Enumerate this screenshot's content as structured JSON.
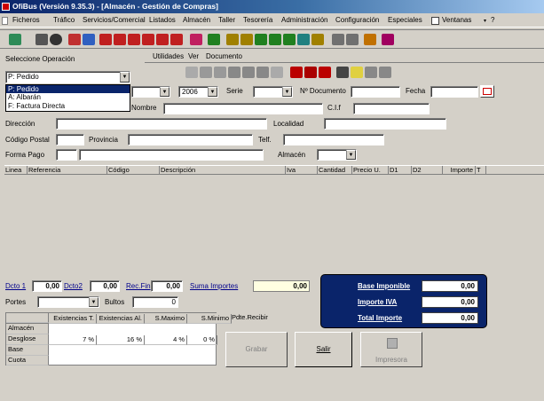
{
  "titlebar": {
    "text": "OfiBus (Versión 9.35.3) - [Almacén - Gestión de Compras]"
  },
  "menu": {
    "items": [
      "Ficheros",
      "Tráfico",
      "Servicios/Comercial",
      "Listados",
      "Almacén",
      "Taller",
      "Tesorería",
      "Administración",
      "Configuración",
      "Especiales",
      "Ventanas",
      "?"
    ]
  },
  "operation": {
    "label": "Seleccione Operación",
    "selected": "P: Pedido",
    "options": [
      "P: Pedido",
      "A: Albarán",
      "F: Factura Directa"
    ]
  },
  "submenu": {
    "items": [
      "Utilidades",
      "Ver",
      "Documento"
    ]
  },
  "form": {
    "year": "2006",
    "serie_label": "Serie",
    "ndoc_label": "Nº Documento",
    "fecha_label": "Fecha",
    "nombre_label": "Nombre",
    "cif_label": "C.I.f",
    "direccion_label": "Dirección",
    "localidad_label": "Localidad",
    "cp_label": "Código Postal",
    "provincia_label": "Provincia",
    "telf_label": "Telf.",
    "formapago_label": "Forma Pago",
    "almacen_label": "Almacén"
  },
  "lines": {
    "columns": [
      "Linea",
      "Referencia",
      "Código",
      "Descripción",
      "Iva",
      "Cantidad",
      "Precio U.",
      "D1",
      "D2",
      "Importe",
      "T"
    ]
  },
  "totals": {
    "dcto1_label": "Dcto 1",
    "dcto1": "0,00",
    "dcto2_label": "Dcto2",
    "dcto2": "0,00",
    "recfin_label": "Rec.Fin",
    "recfin": "0,00",
    "suma_label": "Suma Importes",
    "suma": "0,00",
    "portes_label": "Portes",
    "bultos_label": "Bultos",
    "bultos": "0"
  },
  "panel": {
    "base_label": "Base Imponible",
    "base": "0,00",
    "iva_label": "Importe IVA",
    "iva": "0,00",
    "total_label": "Total Importe",
    "total": "0,00"
  },
  "stock": {
    "columns": [
      "",
      "Existencias T.",
      "Existencias Al.",
      "S.Maximo",
      "S.Minimo",
      "Pdte.Recibir"
    ],
    "rows": [
      [
        "Almacén",
        "",
        "",
        "",
        "",
        ""
      ],
      [
        "Desglose",
        "7 %",
        "16 %",
        "4 %",
        "0 %",
        ""
      ],
      [
        "Base",
        "",
        "",
        "",
        "",
        ""
      ],
      [
        "Cuota",
        "",
        "",
        "",
        "",
        ""
      ]
    ]
  },
  "buttons": {
    "grabar": "Grabar",
    "salir": "Salir",
    "impresora": "Impresora"
  },
  "colors": {
    "title_start": "#0a246a",
    "title_end": "#a6caf0",
    "panel": "#0a246a",
    "selection": "#0a246a"
  }
}
